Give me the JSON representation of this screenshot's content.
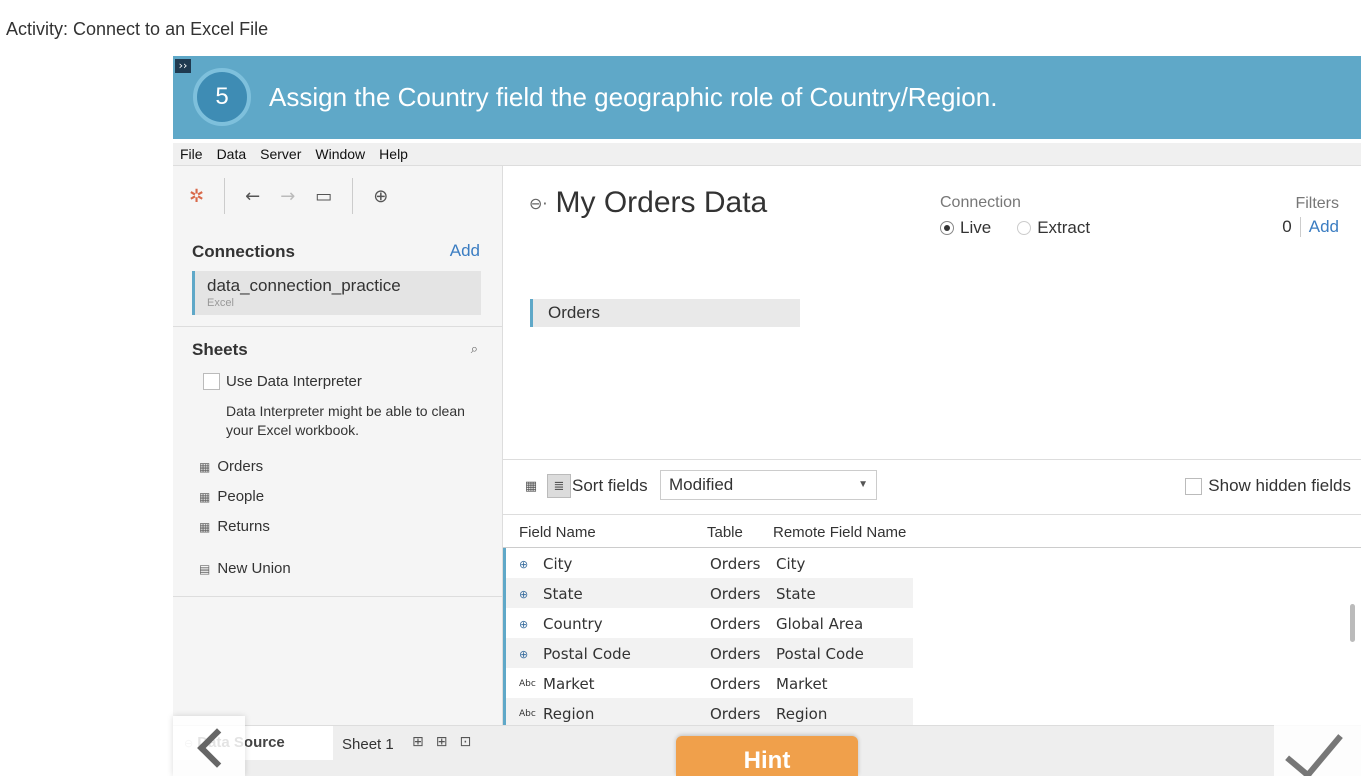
{
  "page": {
    "title": "Activity: Connect to an Excel File"
  },
  "instruction": {
    "step": "5",
    "text": "Assign the Country field the geographic role of Country/Region.",
    "expand_glyph": "››"
  },
  "menu": [
    "File",
    "Data",
    "Server",
    "Window",
    "Help"
  ],
  "left": {
    "connections_title": "Connections",
    "add_label": "Add",
    "connection": {
      "name": "data_connection_practice",
      "type": "Excel"
    },
    "sheets_title": "Sheets",
    "interpreter_label": "Use Data Interpreter",
    "interpreter_note": "Data Interpreter might be able to clean your Excel workbook.",
    "sheets": [
      "Orders",
      "People",
      "Returns"
    ],
    "new_union": "New Union"
  },
  "main": {
    "data_source_name": "My Orders Data",
    "connection_label": "Connection",
    "live_label": "Live",
    "extract_label": "Extract",
    "filters_label": "Filters",
    "filters_count": "0",
    "filters_add": "Add",
    "table_chip": "Orders",
    "sort_label": "Sort fields",
    "sort_value": "Modified",
    "show_hidden": "Show hidden fields",
    "columns": [
      "Field Name",
      "Table",
      "Remote Field Name"
    ],
    "rows": [
      {
        "icon": "globe",
        "field": "City",
        "table": "Orders",
        "remote": "City"
      },
      {
        "icon": "globe",
        "field": "State",
        "table": "Orders",
        "remote": "State"
      },
      {
        "icon": "globe",
        "field": "Country",
        "table": "Orders",
        "remote": "Global Area"
      },
      {
        "icon": "globe",
        "field": "Postal Code",
        "table": "Orders",
        "remote": "Postal Code"
      },
      {
        "icon": "abc",
        "field": "Market",
        "table": "Orders",
        "remote": "Market"
      },
      {
        "icon": "abc",
        "field": "Region",
        "table": "Orders",
        "remote": "Region"
      }
    ]
  },
  "tabs": {
    "data_source": "Data Source",
    "sheet": "Sheet 1"
  },
  "hint_label": "Hint",
  "colors": {
    "banner": "#5fa8c8",
    "accent": "#3b7dc2",
    "hint": "#f0a04b"
  }
}
